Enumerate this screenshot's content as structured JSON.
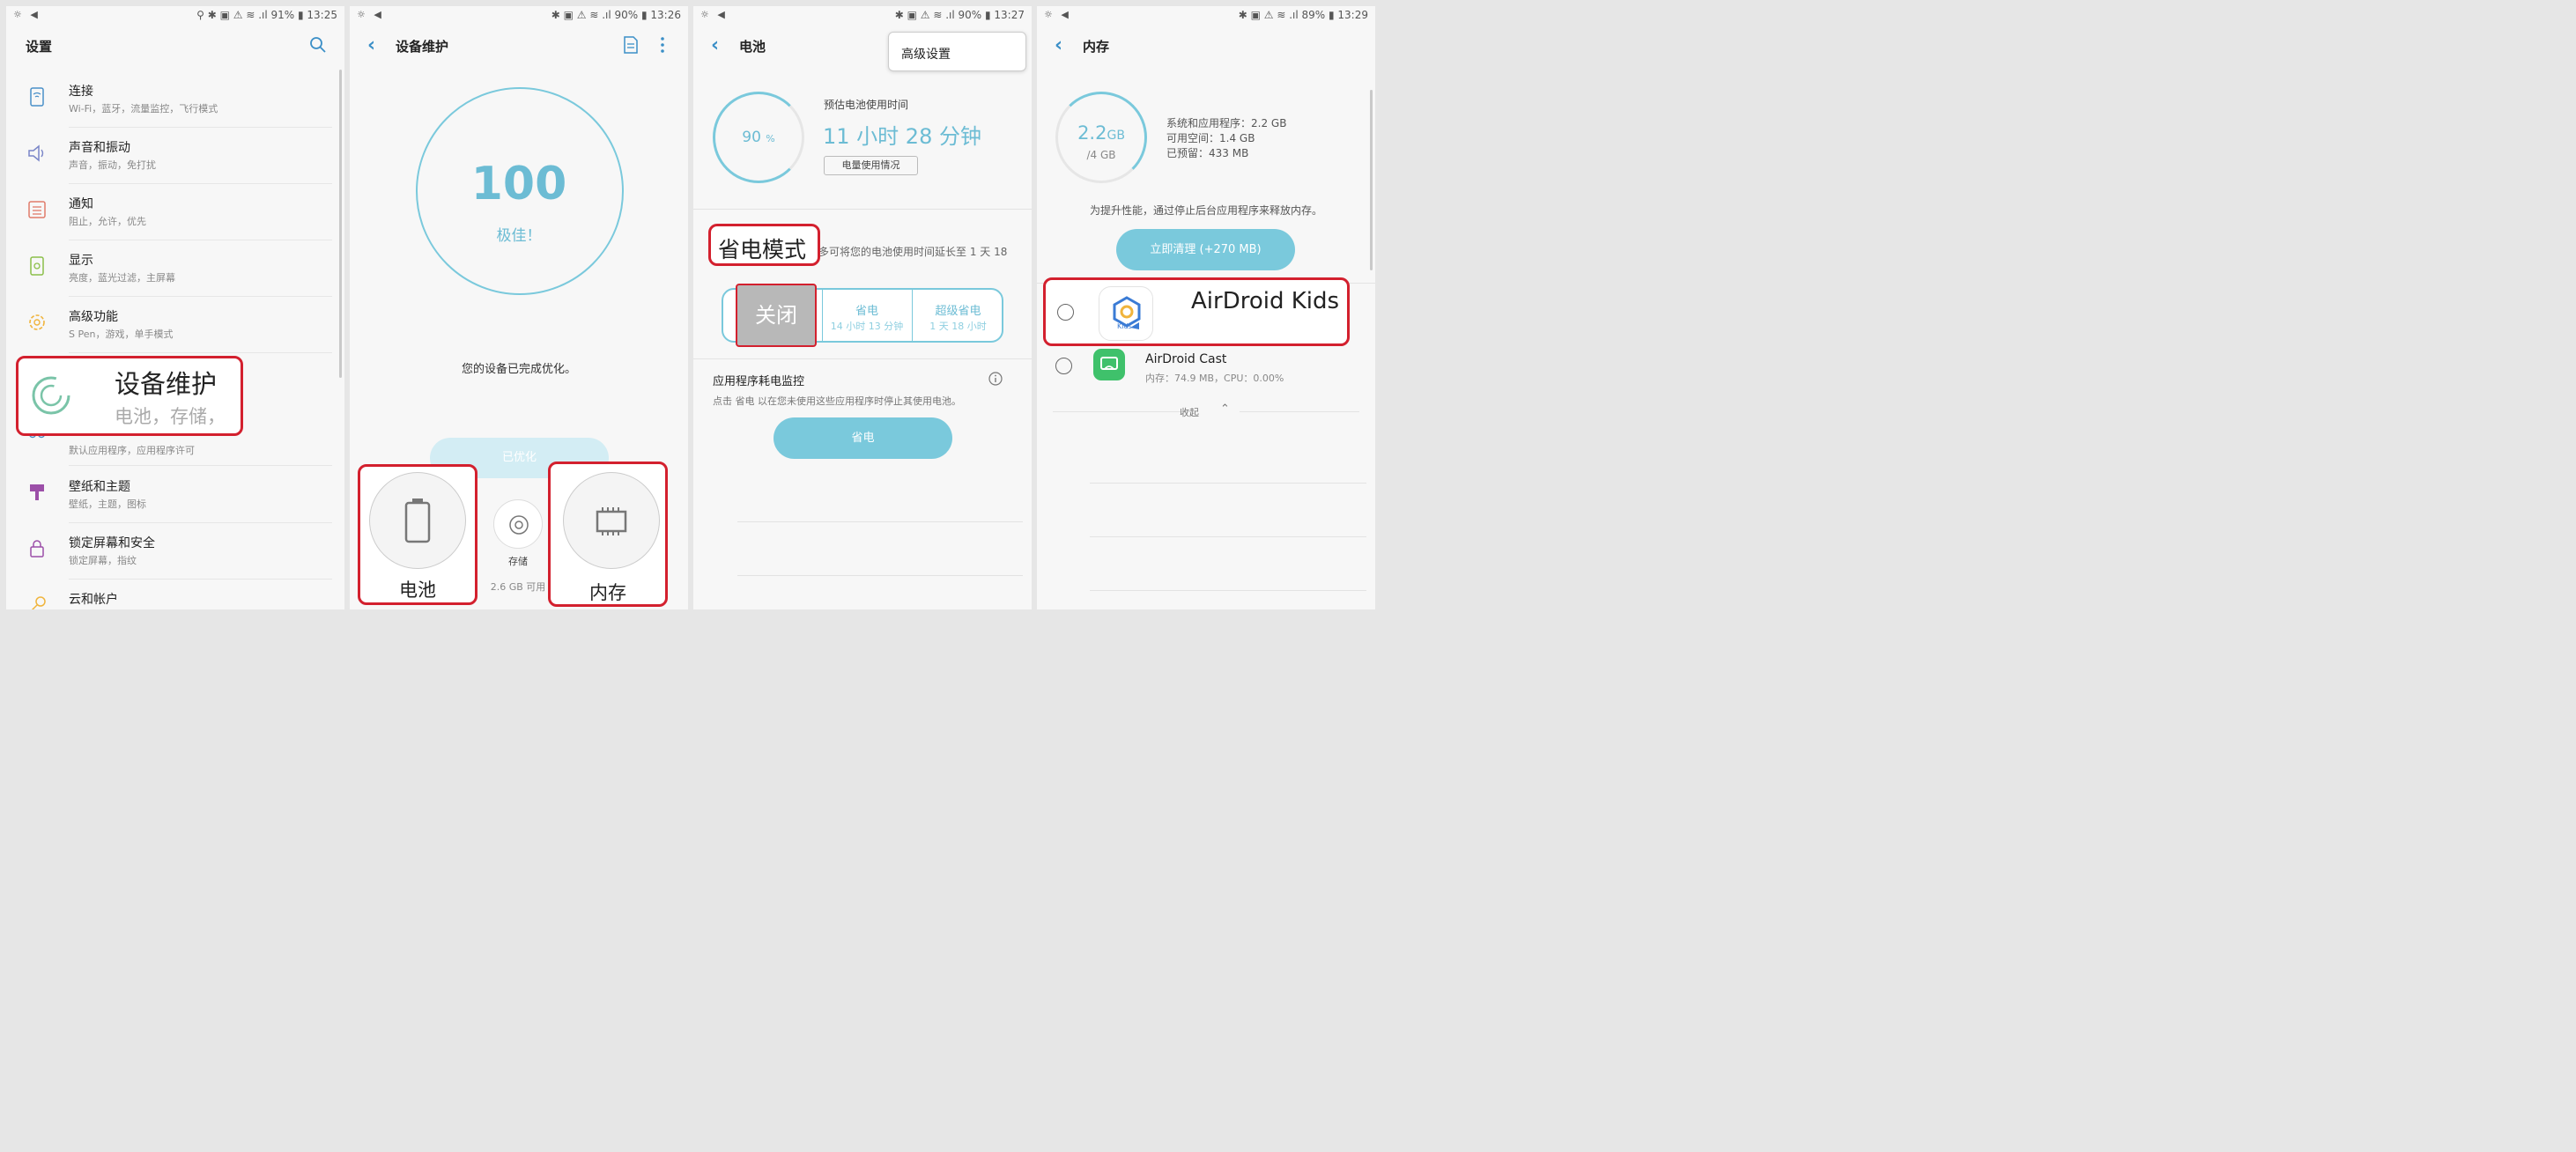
{
  "colors": {
    "accent": "#3b8fc7",
    "teal": "#7ac9dc",
    "highlight": "#d3202e"
  },
  "screen1": {
    "status_left": "☼ ◀",
    "status_right": "⚲ ✱ ▣ ⚠ ≋ .ıl 91% ▮ 13:25",
    "title": "设置",
    "search_icon": "search-icon",
    "items": [
      {
        "label": "连接",
        "desc": "Wi-Fi，蓝牙，流量监控，飞行模式",
        "icon": "connection-icon"
      },
      {
        "label": "声音和振动",
        "desc": "声音，振动，免打扰",
        "icon": "speaker-icon"
      },
      {
        "label": "通知",
        "desc": "阻止，允许，优先",
        "icon": "notification-icon"
      },
      {
        "label": "显示",
        "desc": "亮度，蓝光过滤，主屏幕",
        "icon": "display-icon"
      },
      {
        "label": "高级功能",
        "desc": "S Pen，游戏，单手模式",
        "icon": "gear-icon"
      },
      {
        "label": "",
        "desc": "默认应用程序，应用程序许可",
        "icon": "apps-icon"
      },
      {
        "label": "壁纸和主题",
        "desc": "壁纸，主题，图标",
        "icon": "brush-icon"
      },
      {
        "label": "锁定屏幕和安全",
        "desc": "锁定屏幕，指纹",
        "icon": "lock-icon"
      },
      {
        "label": "云和帐户",
        "desc": "",
        "icon": "key-icon"
      }
    ],
    "highlight": {
      "title": "设备维护",
      "desc": "电池，存储，"
    }
  },
  "screen2": {
    "status_left": "☼ ◀",
    "status_right": "✱ ▣ ⚠ ≋ .ıl 90% ▮ 13:26",
    "title": "设备维护",
    "score": "100",
    "score_label": "极佳！",
    "optimized_msg": "您的设备已完成优化。",
    "optimized_btn": "已优化",
    "battery_label": "电池",
    "storage_label": "存储",
    "storage_value": "2.6 GB 可用",
    "memory_label": "内存"
  },
  "screen3": {
    "status_left": "☼ ◀",
    "status_right": "✱ ▣ ⚠ ≋ .ıl 90% ▮ 13:27",
    "title": "电池",
    "popup_menu": "高级设置",
    "percent": "90",
    "percent_unit": "%",
    "estimate_label": "预估电池使用时间",
    "estimate_value": "11 小时 28 分钟",
    "usage_btn": "电量使用情况",
    "mode_title": "省电模式",
    "mode_desc": "多可将您的电池使用时间延长至 1 天 18",
    "mode_off": "关闭",
    "mode_save": "省电",
    "mode_save_sub": "14 小时 13 分钟",
    "mode_super": "超级省电",
    "mode_super_sub": "1 天 18 小时",
    "monitor_title": "应用程序耗电监控",
    "monitor_desc": "点击 省电 以在您未使用这些应用程序时停止其使用电池。",
    "save_btn": "省电"
  },
  "screen4": {
    "status_left": "☼ ◀",
    "status_right": "✱ ▣ ⚠ ≋ .ıl 89% ▮ 13:29",
    "title": "内存",
    "used": "2.2",
    "used_unit": "GB",
    "total": "/4 GB",
    "stat_system": "系统和应用程序：2.2 GB",
    "stat_free": "可用空间：1.4 GB",
    "stat_reserved": "已预留：433 MB",
    "tip": "为提升性能，通过停止后台应用程序来释放内存。",
    "clean_btn": "立即清理 (+270 MB)",
    "app1_name": "AirDroid Kids",
    "app1_icon_text": "Kids",
    "app2_name": "AirDroid Cast",
    "app2_detail": "内存：74.9 MB，CPU：0.00%",
    "collapse": "收起"
  }
}
